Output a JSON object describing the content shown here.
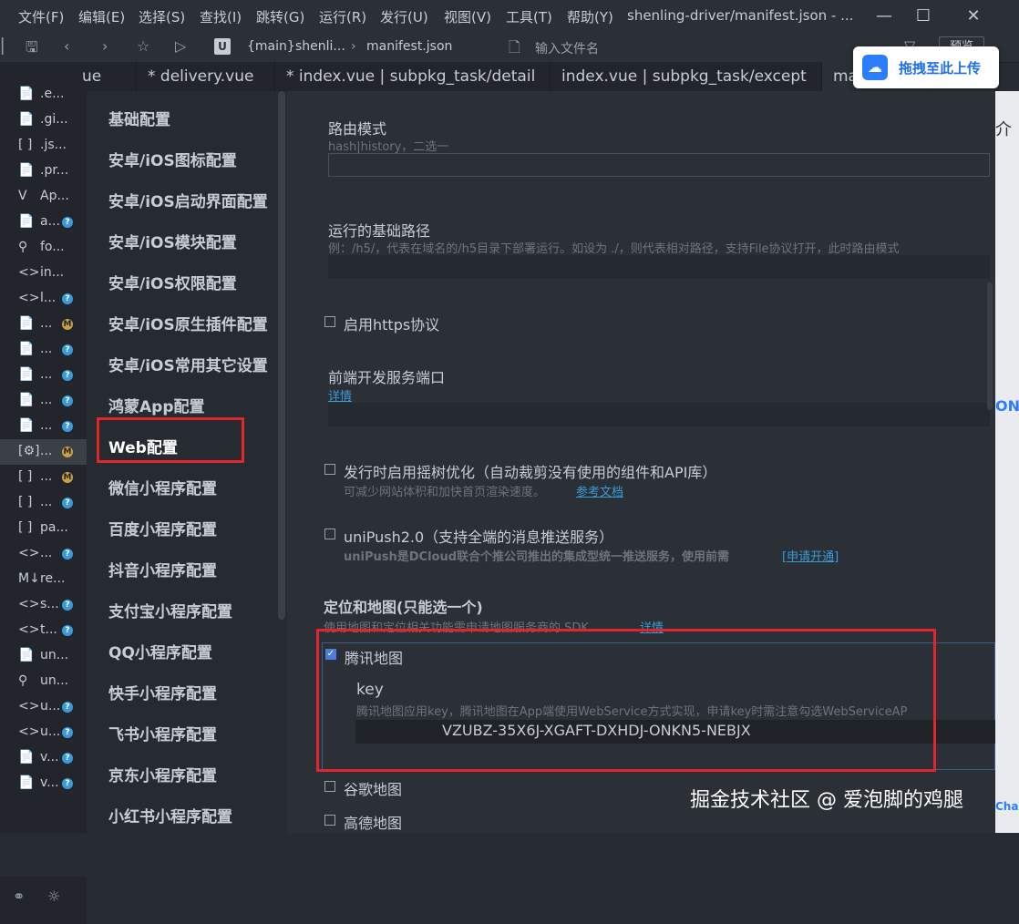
{
  "menu": [
    "文件(F)",
    "编辑(E)",
    "选择(S)",
    "查找(I)",
    "跳转(G)",
    "运行(R)",
    "发行(U)",
    "视图(V)",
    "工具(T)",
    "帮助(Y)"
  ],
  "window_title": "shenling-driver/manifest.json - ...",
  "toolbar": {
    "branch": "{main}",
    "project": "shenli...",
    "file": "manifest.json",
    "search_placeholder": "输入文件名",
    "preview": "预览",
    "badge": "U"
  },
  "tabs": [
    "ue",
    "* delivery.vue",
    "* index.vue | subpkg_task/detail",
    "index.vue | subpkg_task/except",
    "ma"
  ],
  "upload": {
    "label": "拖拽至此上传"
  },
  "files": [
    {
      "icon": "📄",
      "name": ".e...",
      "badge": ""
    },
    {
      "icon": "📄",
      "name": ".gi...",
      "badge": ""
    },
    {
      "icon": "[ ]",
      "name": ".js...",
      "badge": ""
    },
    {
      "icon": "📄",
      "name": ".pr...",
      "badge": ""
    },
    {
      "icon": "V",
      "name": "Ap...",
      "badge": ""
    },
    {
      "icon": "📄",
      "name": "a...",
      "badge": "?"
    },
    {
      "icon": "⚲",
      "name": "fo...",
      "badge": ""
    },
    {
      "icon": "<>",
      "name": "in...",
      "badge": ""
    },
    {
      "icon": "<>",
      "name": "l...",
      "badge": "?"
    },
    {
      "icon": "📄",
      "name": "...",
      "badge": "M"
    },
    {
      "icon": "📄",
      "name": "...",
      "badge": "?"
    },
    {
      "icon": "📄",
      "name": "...",
      "badge": "?"
    },
    {
      "icon": "📄",
      "name": "...",
      "badge": "?"
    },
    {
      "icon": "📄",
      "name": "...",
      "badge": "?"
    },
    {
      "icon": "[⚙]",
      "name": "...",
      "badge": "M"
    },
    {
      "icon": "[ ]",
      "name": "...",
      "badge": "M"
    },
    {
      "icon": "[ ]",
      "name": "...",
      "badge": "?"
    },
    {
      "icon": "[ ]",
      "name": "pa...",
      "badge": ""
    },
    {
      "icon": "<>",
      "name": "...",
      "badge": "?"
    },
    {
      "icon": "M↓",
      "name": "re...",
      "badge": ""
    },
    {
      "icon": "<>",
      "name": "s...",
      "badge": "?"
    },
    {
      "icon": "<>",
      "name": "t...",
      "badge": "?"
    },
    {
      "icon": "📄",
      "name": "un...",
      "badge": ""
    },
    {
      "icon": "⚲",
      "name": "un...",
      "badge": ""
    },
    {
      "icon": "<>",
      "name": "u...",
      "badge": "?"
    },
    {
      "icon": "<>",
      "name": "u...",
      "badge": "?"
    },
    {
      "icon": "📄",
      "name": "v...",
      "badge": "?"
    },
    {
      "icon": "📄",
      "name": "v...",
      "badge": "?"
    }
  ],
  "nav": [
    "基础配置",
    "安卓/iOS图标配置",
    "安卓/iOS启动界面配置",
    "安卓/iOS模块配置",
    "安卓/iOS权限配置",
    "安卓/iOS原生插件配置",
    "安卓/iOS常用其它设置",
    "鸿蒙App配置",
    "Web配置",
    "微信小程序配置",
    "百度小程序配置",
    "抖音小程序配置",
    "支付宝小程序配置",
    "QQ小程序配置",
    "快手小程序配置",
    "飞书小程序配置",
    "京东小程序配置",
    "小红书小程序配置"
  ],
  "nav_active": "Web配置",
  "form": {
    "router_mode": {
      "label": "路由模式",
      "desc": "hash|history，二选一"
    },
    "base_path": {
      "label": "运行的基础路径",
      "desc": "例：/h5/，代表在域名的/h5目录下部署运行。如设为 ./，则代表相对路径，支持File协议打开，此时路由模式"
    },
    "https": {
      "label": "启用https协议",
      "checked": false
    },
    "dev_port": {
      "label": "前端开发服务端口",
      "link": "详情"
    },
    "tree_shaking": {
      "label": "发行时启用摇树优化（自动裁剪没有使用的组件和API库）",
      "desc": "可减少网站体积和加快首页渲染速度。",
      "link": "参考文档",
      "checked": false
    },
    "unipush": {
      "label": "uniPush2.0（支持全端的消息推送服务）",
      "desc": "uniPush是DCloud联合个推公司推出的集成型统一推送服务，使用前需",
      "link": "[申请开通]",
      "checked": false
    },
    "map_section": {
      "title": "定位和地图(只能选一个)",
      "desc": "使用地图和定位相关功能需申请地图服务商的 SDK",
      "link": "详情"
    },
    "tencent_map": {
      "label": "腾讯地图",
      "checked": true,
      "key_label": "key",
      "key_desc": "腾讯地图应用key，腾讯地图在App端使用WebService方式实现，申请key时需注意勾选WebServiceAP",
      "key_value": "VZUBZ-35X6J-XGAFT-DXHDJ-ONKN5-NEBJX"
    },
    "google_map": {
      "label": "谷歌地图",
      "checked": false
    },
    "amap": {
      "label": "高德地图",
      "checked": false
    }
  },
  "right_strip": {
    "text1": "介",
    "text2": "ONI",
    "text3": "Cha"
  },
  "watermark": "掘金技术社区 @ 爱泡脚的鸡腿",
  "colors": {
    "highlight_red": "#e0262b",
    "link_blue": "#3a9bd9",
    "checkbox_blue": "#4a7cd9"
  }
}
